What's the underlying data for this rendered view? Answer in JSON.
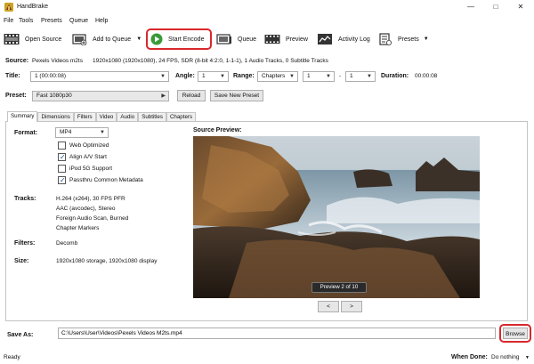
{
  "window": {
    "title": "HandBrake"
  },
  "menu": [
    "File",
    "Tools",
    "Presets",
    "Queue",
    "Help"
  ],
  "toolbar": {
    "open_source": "Open Source",
    "add_to_queue": "Add to Queue",
    "start_encode": "Start Encode",
    "queue": "Queue",
    "preview": "Preview",
    "activity_log": "Activity Log",
    "presets": "Presets"
  },
  "source": {
    "label": "Source:",
    "name": "Pexels Videos m2ts",
    "details": "1920x1080 (1920x1080), 24 FPS, SDR (8-bit 4:2:0, 1-1-1), 1 Audio Tracks, 0 Subtitle Tracks"
  },
  "title_row": {
    "title_label": "Title:",
    "title_value": "1 (00:00:08)",
    "angle_label": "Angle:",
    "angle_value": "1",
    "range_label": "Range:",
    "range_value": "Chapters",
    "range_start": "1",
    "dash": "-",
    "range_end": "1",
    "duration_label": "Duration:",
    "duration_value": "00:00:08"
  },
  "preset_row": {
    "label": "Preset:",
    "value": "Fast 1080p30",
    "reload": "Reload",
    "save_new": "Save New Preset"
  },
  "tabs": [
    "Summary",
    "Dimensions",
    "Filters",
    "Video",
    "Audio",
    "Subtitles",
    "Chapters"
  ],
  "summary": {
    "format_label": "Format:",
    "format_value": "MP4",
    "options": [
      {
        "label": "Web Optimized",
        "checked": false
      },
      {
        "label": "Align A/V Start",
        "checked": true
      },
      {
        "label": "iPod 5G Support",
        "checked": false
      },
      {
        "label": "Passthru Common Metadata",
        "checked": true
      }
    ],
    "tracks_label": "Tracks:",
    "tracks": [
      "H.264 (x264), 30 FPS PFR",
      "AAC (avcodec), Stereo",
      "Foreign Audio Scan, Burned",
      "Chapter Markers"
    ],
    "filters_label": "Filters:",
    "filters_value": "Decomb",
    "size_label": "Size:",
    "size_value": "1920x1080 storage, 1920x1080 display"
  },
  "preview": {
    "label": "Source Preview:",
    "counter": "Preview 2 of 10",
    "prev": "<",
    "next": ">"
  },
  "save_as": {
    "label": "Save As:",
    "path": "C:\\Users\\User\\Videos\\Pexels Videos M2ts.mp4",
    "browse": "Browse"
  },
  "status": {
    "text": "Ready",
    "when_done_label": "When Done:",
    "when_done_value": "Do nothing"
  },
  "colors": {
    "highlight": "#d8282c",
    "accent": "#2a6ebb",
    "play_green": "#3a9a3a"
  }
}
